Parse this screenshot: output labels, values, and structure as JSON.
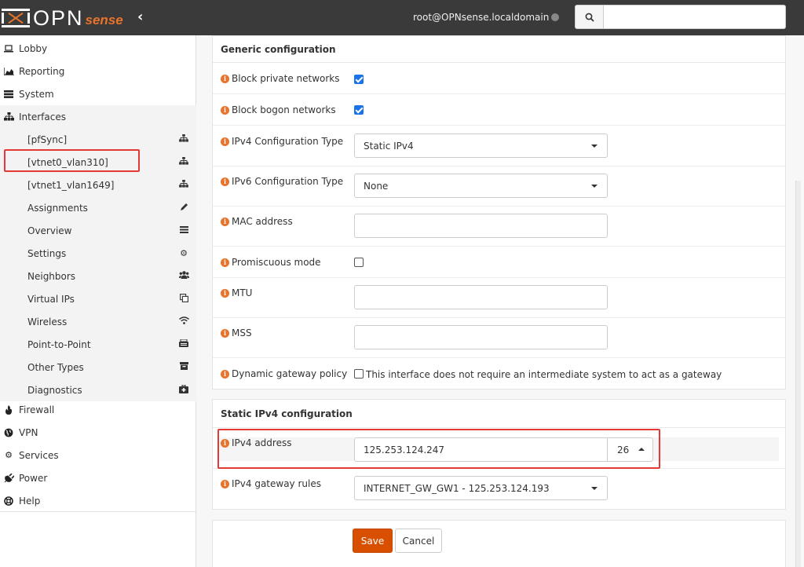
{
  "header": {
    "logo_text": "OPN",
    "logo_sense": "sense",
    "user": "root@OPNsense.localdomain",
    "search_placeholder": ""
  },
  "sidebar": {
    "items": [
      {
        "label": "Lobby",
        "icon": "laptop-icon"
      },
      {
        "label": "Reporting",
        "icon": "area-chart-icon"
      },
      {
        "label": "System",
        "icon": "server-icon"
      },
      {
        "label": "Interfaces",
        "icon": "sitemap-icon"
      }
    ],
    "interfaces_sub": [
      {
        "label": "[pfSync]",
        "icon": "sitemap-icon"
      },
      {
        "label": "[vtnet0_vlan310]",
        "icon": "sitemap-icon"
      },
      {
        "label": "[vtnet1_vlan1649]",
        "icon": "sitemap-icon"
      },
      {
        "label": "Assignments",
        "icon": "pencil-icon"
      },
      {
        "label": "Overview",
        "icon": "list-icon"
      },
      {
        "label": "Settings",
        "icon": "cogs-icon"
      },
      {
        "label": "Neighbors",
        "icon": "users-icon"
      },
      {
        "label": "Virtual IPs",
        "icon": "clone-icon"
      },
      {
        "label": "Wireless",
        "icon": "wifi-icon"
      },
      {
        "label": "Point-to-Point",
        "icon": "fax-icon"
      },
      {
        "label": "Other Types",
        "icon": "archive-icon"
      },
      {
        "label": "Diagnostics",
        "icon": "medkit-icon"
      }
    ],
    "bottom_items": [
      {
        "label": "Firewall",
        "icon": "fire-icon"
      },
      {
        "label": "VPN",
        "icon": "globe-icon"
      },
      {
        "label": "Services",
        "icon": "cog-icon"
      },
      {
        "label": "Power",
        "icon": "plug-icon"
      },
      {
        "label": "Help",
        "icon": "life-ring-icon"
      }
    ]
  },
  "generic": {
    "title": "Generic configuration",
    "block_private_label": "Block private networks",
    "block_private_checked": true,
    "block_bogon_label": "Block bogon networks",
    "block_bogon_checked": true,
    "ipv4_type_label": "IPv4 Configuration Type",
    "ipv4_type_value": "Static IPv4",
    "ipv6_type_label": "IPv6 Configuration Type",
    "ipv6_type_value": "None",
    "mac_label": "MAC address",
    "mac_value": "",
    "promisc_label": "Promiscuous mode",
    "promisc_checked": false,
    "mtu_label": "MTU",
    "mtu_value": "",
    "mss_label": "MSS",
    "mss_value": "",
    "dyn_gw_label": "Dynamic gateway policy",
    "dyn_gw_text": "This interface does not require an intermediate system to act as a gateway",
    "dyn_gw_checked": false
  },
  "static_ipv4": {
    "title": "Static IPv4 configuration",
    "address_label": "IPv4 address",
    "address_value": "125.253.124.247",
    "mask_value": "26",
    "gateway_label": "IPv4 gateway rules",
    "gateway_value": "INTERNET_GW_GW1 - 125.253.124.193"
  },
  "actions": {
    "save": "Save",
    "cancel": "Cancel"
  },
  "colors": {
    "accent": "#d94f00",
    "checkbox": "#1a73e8",
    "highlight": "#e53935"
  }
}
